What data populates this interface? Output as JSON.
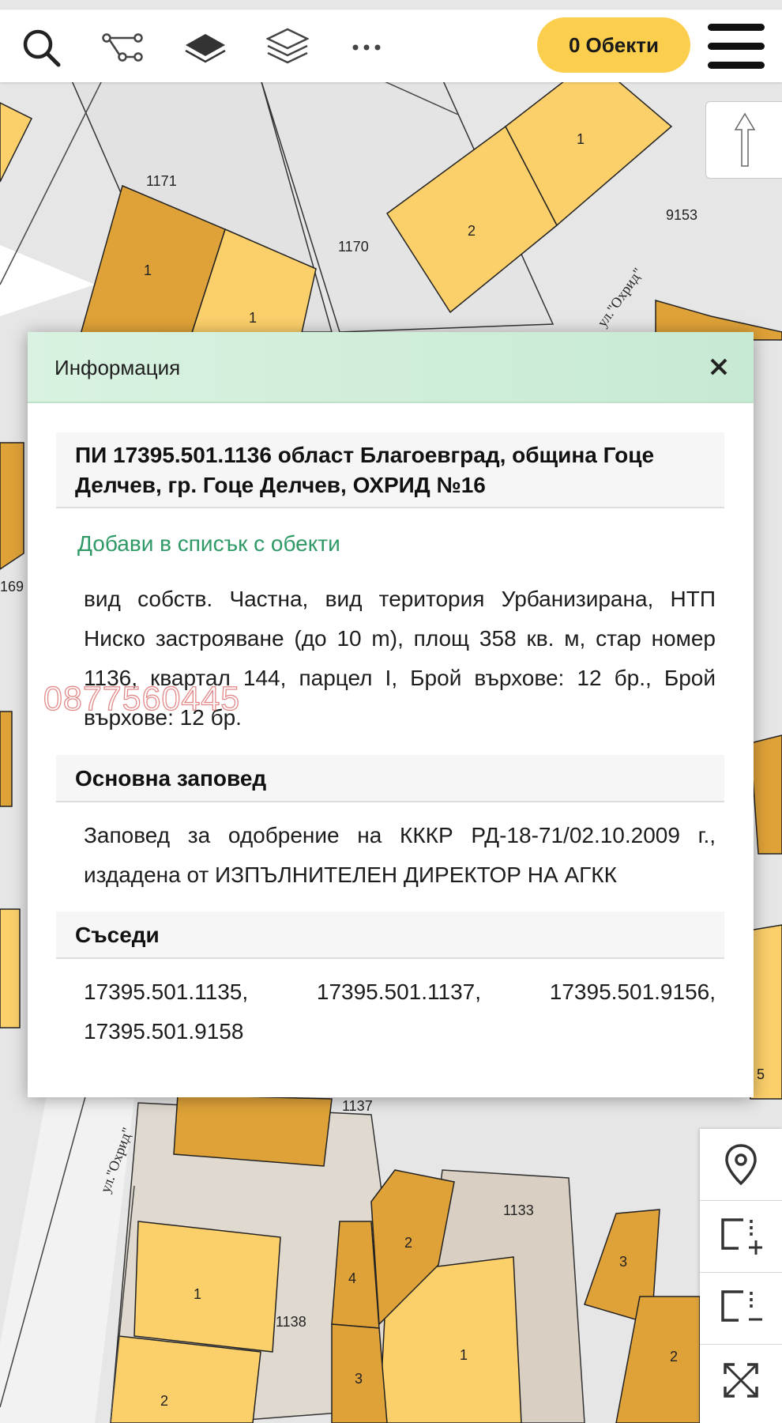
{
  "toolbar": {
    "icons": [
      "search-icon",
      "route-icon",
      "layer-icon",
      "layers-icon",
      "more-icon"
    ],
    "objects_count": "0",
    "objects_label": "Обекти",
    "objects_color": "#fbcf4d"
  },
  "map": {
    "parcel_labels": [
      "1171",
      "1170",
      "9153",
      "1",
      "2",
      "1",
      "1",
      "169",
      "1137",
      "1133",
      "1138",
      "1",
      "2",
      "3",
      "4",
      "2",
      "3",
      "1",
      "2",
      "5"
    ],
    "street_labels": [
      "ул.\"Охрид\"",
      "ул.\"Охрид\""
    ],
    "colors": {
      "parcel_light": "#fbcf6a",
      "parcel_dark": "#dfa238",
      "background": "#e6e6e6",
      "road": "#ffffff"
    }
  },
  "dialog": {
    "title": "Информация",
    "property_heading": "ПИ 17395.501.1136 област Благоевград, община Гоце Делчев, гр. Гоце Делчев, ОХРИД №16",
    "add_link": "Добави в списък с обекти",
    "description": "вид собств. Частна, вид територия Урбанизирана, НТП Ниско застрояване (до 10 m), площ 358 кв. м, стар номер 1136, квартал 144, парцел I, Брой върхове: 12 бр., Брой върхове: 12 бр.",
    "watermark": "0877560445",
    "order_heading": "Основна заповед",
    "order_text": "Заповед за одобрение на КККР РД-18-71/02.10.2009 г., издадена от ИЗПЪЛНИТЕЛЕН ДИРЕКТОР НА АГКК",
    "neighbors_heading": "Съседи",
    "neighbors_text": "17395.501.1135, 17395.501.1137, 17395.501.9156, 17395.501.9158",
    "link_color": "#2f9a67",
    "header_color": "#d2efdc"
  },
  "side_tools": [
    "map-pin-icon",
    "add-area-icon",
    "remove-area-icon",
    "fullscreen-icon"
  ],
  "north_arrow": "north-arrow-icon"
}
